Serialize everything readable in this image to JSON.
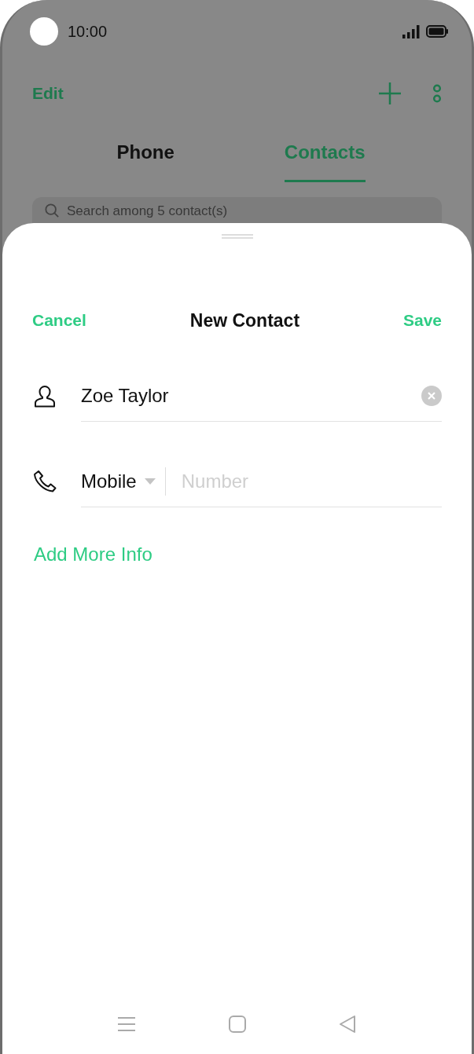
{
  "status_bar": {
    "time": "10:00"
  },
  "toolbar": {
    "edit": "Edit"
  },
  "tabs": [
    {
      "label": "Phone",
      "selected": false
    },
    {
      "label": "Contacts",
      "selected": true
    }
  ],
  "search": {
    "placeholder": "Search among 5 contact(s)"
  },
  "sheet": {
    "cancel": "Cancel",
    "title": "New Contact",
    "save": "Save",
    "name": {
      "value": "Zoe Taylor"
    },
    "phone": {
      "label": "Mobile",
      "placeholder": "Number"
    },
    "add_more": "Add More Info"
  }
}
